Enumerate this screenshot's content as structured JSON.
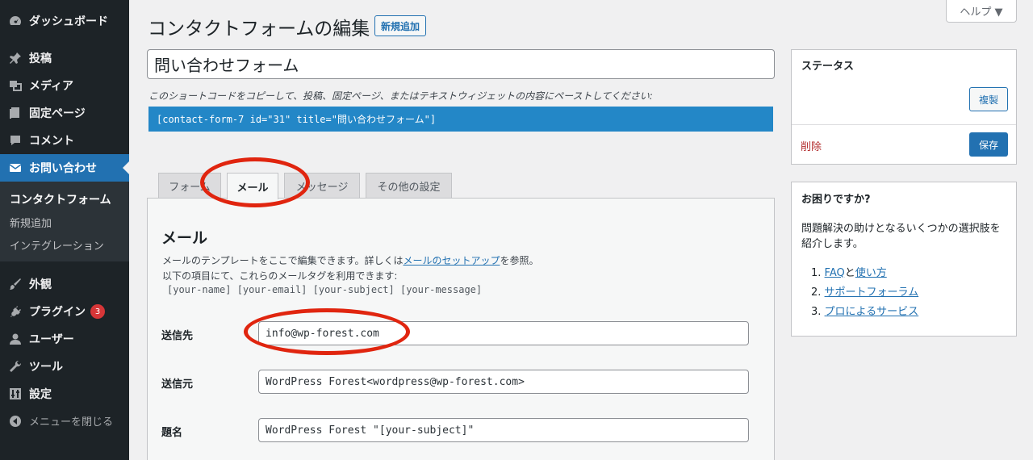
{
  "sidebar": {
    "items": [
      {
        "label": "ダッシュボード",
        "icon": "dashboard-icon"
      },
      {
        "label": "投稿",
        "icon": "pin-icon"
      },
      {
        "label": "メディア",
        "icon": "media-icon"
      },
      {
        "label": "固定ページ",
        "icon": "page-icon"
      },
      {
        "label": "コメント",
        "icon": "comment-icon"
      },
      {
        "label": "お問い合わせ",
        "icon": "mail-icon"
      },
      {
        "label": "外観",
        "icon": "brush-icon"
      },
      {
        "label": "プラグイン",
        "icon": "plugin-icon",
        "badge": "3"
      },
      {
        "label": "ユーザー",
        "icon": "user-icon"
      },
      {
        "label": "ツール",
        "icon": "wrench-icon"
      },
      {
        "label": "設定",
        "icon": "settings-icon"
      }
    ],
    "submenu": [
      "コンタクトフォーム",
      "新規追加",
      "インテグレーション"
    ],
    "collapse_label": "メニューを閉じる"
  },
  "header": {
    "help_label": "ヘルプ ▼",
    "title": "コンタクトフォームの編集",
    "add_new": "新規追加"
  },
  "form": {
    "title_value": "問い合わせフォーム",
    "shortcode_desc": "このショートコードをコピーして、投稿、固定ページ、またはテキストウィジェットの内容にペーストしてください:",
    "shortcode": "[contact-form-7 id=\"31\" title=\"問い合わせフォーム\"]"
  },
  "tabs": [
    {
      "label": "フォーム"
    },
    {
      "label": "メール"
    },
    {
      "label": "メッセージ"
    },
    {
      "label": "その他の設定"
    }
  ],
  "mail_panel": {
    "title": "メール",
    "desc_1_pre": "メールのテンプレートをここで編集できます。詳しくは",
    "desc_1_link": "メールのセットアップ",
    "desc_1_post": "を参照。",
    "desc_2": "以下の項目にて、これらのメールタグを利用できます:",
    "tags": "[your-name] [your-email] [your-subject] [your-message]",
    "fields": [
      {
        "label": "送信先",
        "value": "info@wp-forest.com"
      },
      {
        "label": "送信元",
        "value": "WordPress Forest<wordpress@wp-forest.com>"
      },
      {
        "label": "題名",
        "value": "WordPress Forest \"[your-subject]\""
      }
    ]
  },
  "status_box": {
    "title": "ステータス",
    "duplicate": "複製",
    "delete": "削除",
    "save": "保存"
  },
  "help_box": {
    "title": "お困りですか?",
    "text_1": "問題解決の助けとなるいくつかの選択肢を",
    "text_2": "紹介します。",
    "items": [
      {
        "num": "1.",
        "link1": "FAQ",
        "mid": "と",
        "link2": "使い方"
      },
      {
        "num": "2.",
        "link1": "サポートフォーラム"
      },
      {
        "num": "3.",
        "link1": "プロによるサービス"
      }
    ]
  },
  "colors": {
    "accent": "#2271b1",
    "sidebar_bg": "#1d2327",
    "shortcode_bg": "#2387c7",
    "annotation": "#e0250f"
  }
}
